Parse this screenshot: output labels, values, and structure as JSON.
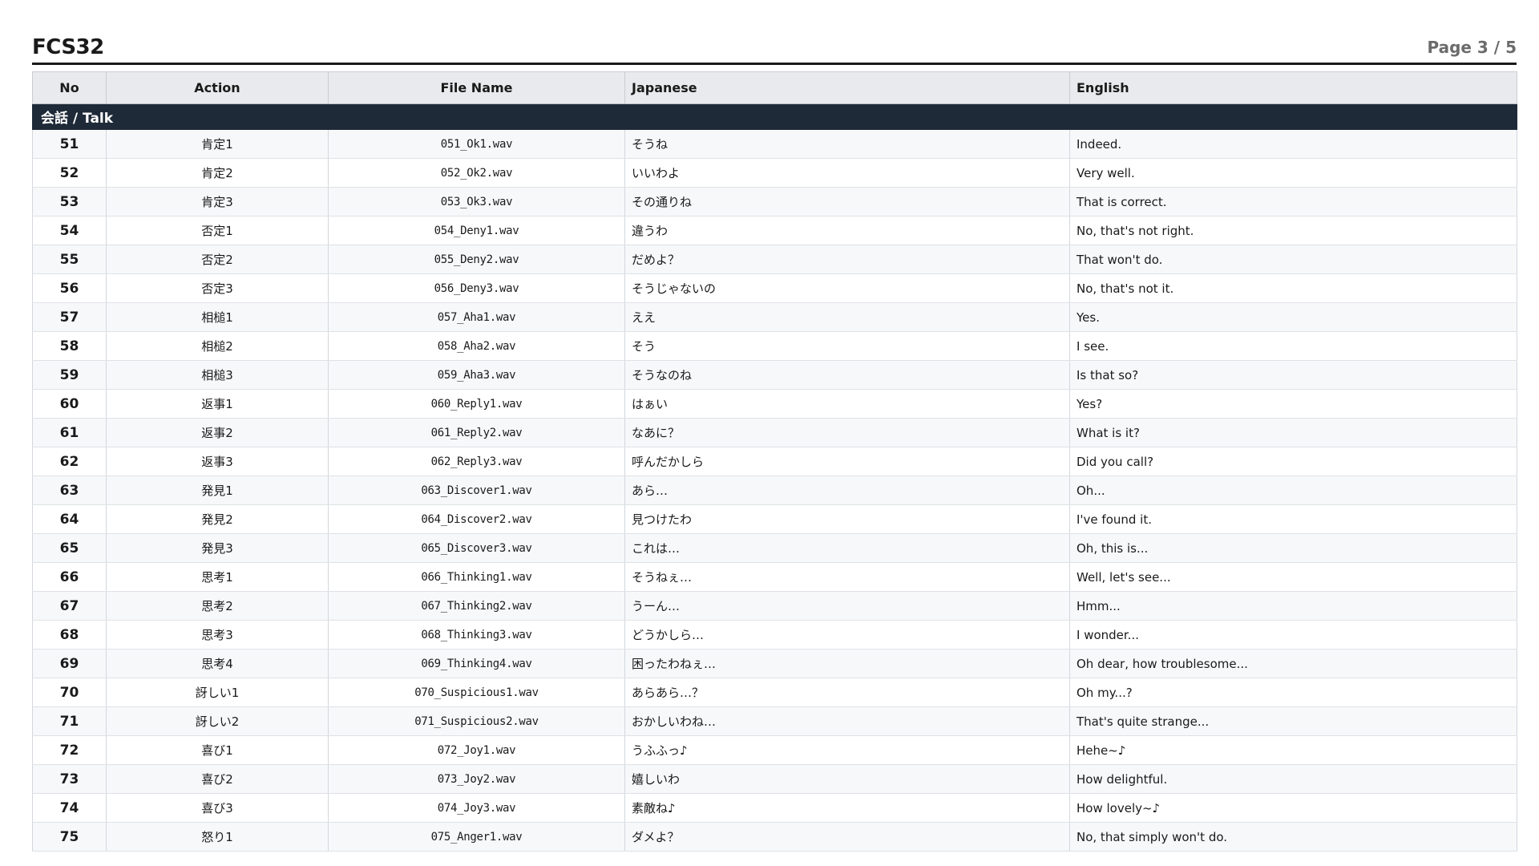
{
  "header": {
    "title": "FCS32",
    "page": "Page 3 / 5"
  },
  "table": {
    "columns": [
      "No",
      "Action",
      "File Name",
      "Japanese",
      "English"
    ],
    "section_label": "会話 / Talk",
    "rows": [
      {
        "no": "51",
        "action": "肯定1",
        "file": "051_Ok1.wav",
        "ja": "そうね",
        "en": "Indeed."
      },
      {
        "no": "52",
        "action": "肯定2",
        "file": "052_Ok2.wav",
        "ja": "いいわよ",
        "en": "Very well."
      },
      {
        "no": "53",
        "action": "肯定3",
        "file": "053_Ok3.wav",
        "ja": "その通りね",
        "en": "That is correct."
      },
      {
        "no": "54",
        "action": "否定1",
        "file": "054_Deny1.wav",
        "ja": "違うわ",
        "en": "No, that's not right."
      },
      {
        "no": "55",
        "action": "否定2",
        "file": "055_Deny2.wav",
        "ja": "だめよ？",
        "en": "That won't do."
      },
      {
        "no": "56",
        "action": "否定3",
        "file": "056_Deny3.wav",
        "ja": "そうじゃないの",
        "en": "No, that's not it."
      },
      {
        "no": "57",
        "action": "相槌1",
        "file": "057_Aha1.wav",
        "ja": "ええ",
        "en": "Yes."
      },
      {
        "no": "58",
        "action": "相槌2",
        "file": "058_Aha2.wav",
        "ja": "そう",
        "en": "I see."
      },
      {
        "no": "59",
        "action": "相槌3",
        "file": "059_Aha3.wav",
        "ja": "そうなのね",
        "en": "Is that so?"
      },
      {
        "no": "60",
        "action": "返事1",
        "file": "060_Reply1.wav",
        "ja": "はぁい",
        "en": "Yes?"
      },
      {
        "no": "61",
        "action": "返事2",
        "file": "061_Reply2.wav",
        "ja": "なあに？",
        "en": "What is it?"
      },
      {
        "no": "62",
        "action": "返事3",
        "file": "062_Reply3.wav",
        "ja": "呼んだかしら",
        "en": "Did you call?"
      },
      {
        "no": "63",
        "action": "発見1",
        "file": "063_Discover1.wav",
        "ja": "あら…",
        "en": "Oh..."
      },
      {
        "no": "64",
        "action": "発見2",
        "file": "064_Discover2.wav",
        "ja": "見つけたわ",
        "en": "I've found it."
      },
      {
        "no": "65",
        "action": "発見3",
        "file": "065_Discover3.wav",
        "ja": "これは…",
        "en": "Oh, this is..."
      },
      {
        "no": "66",
        "action": "思考1",
        "file": "066_Thinking1.wav",
        "ja": "そうねぇ…",
        "en": "Well, let's see..."
      },
      {
        "no": "67",
        "action": "思考2",
        "file": "067_Thinking2.wav",
        "ja": "うーん…",
        "en": "Hmm..."
      },
      {
        "no": "68",
        "action": "思考3",
        "file": "068_Thinking3.wav",
        "ja": "どうかしら…",
        "en": "I wonder..."
      },
      {
        "no": "69",
        "action": "思考4",
        "file": "069_Thinking4.wav",
        "ja": "困ったわねぇ…",
        "en": "Oh dear, how troublesome..."
      },
      {
        "no": "70",
        "action": "訝しい1",
        "file": "070_Suspicious1.wav",
        "ja": "あらあら…？",
        "en": "Oh my...?"
      },
      {
        "no": "71",
        "action": "訝しい2",
        "file": "071_Suspicious2.wav",
        "ja": "おかしいわね…",
        "en": "That's quite strange..."
      },
      {
        "no": "72",
        "action": "喜び1",
        "file": "072_Joy1.wav",
        "ja": "うふふっ♪",
        "en": "Hehe~♪"
      },
      {
        "no": "73",
        "action": "喜び2",
        "file": "073_Joy2.wav",
        "ja": "嬉しいわ",
        "en": "How delightful."
      },
      {
        "no": "74",
        "action": "喜び3",
        "file": "074_Joy3.wav",
        "ja": "素敵ね♪",
        "en": "How lovely~♪"
      },
      {
        "no": "75",
        "action": "怒り1",
        "file": "075_Anger1.wav",
        "ja": "ダメよ？",
        "en": "No, that simply won't do."
      }
    ]
  }
}
